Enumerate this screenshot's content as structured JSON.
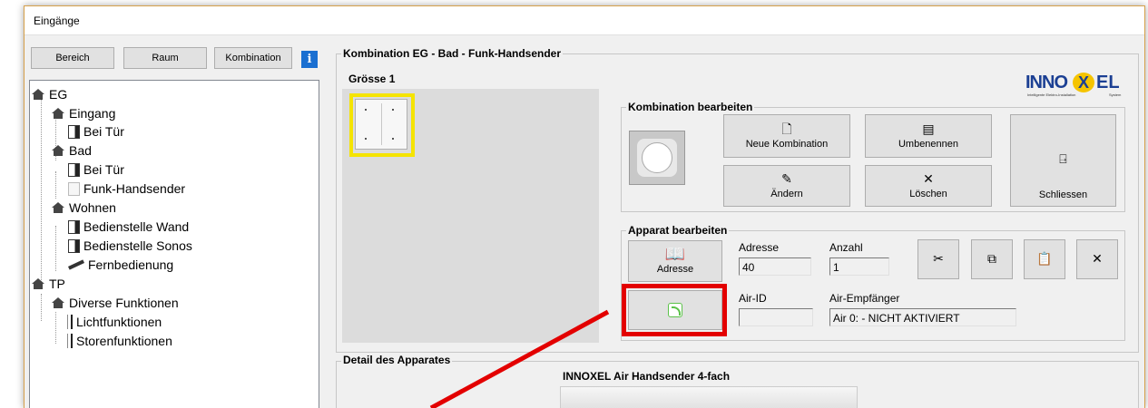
{
  "window": {
    "title": "Eingänge"
  },
  "toolbar": {
    "bereich": "Bereich",
    "raum": "Raum",
    "kombination": "Kombination",
    "info": "i"
  },
  "tree": [
    {
      "label": "EG",
      "kind": "house"
    },
    {
      "label": "Eingang",
      "kind": "house"
    },
    {
      "label": "Bei Tür",
      "kind": "switch"
    },
    {
      "label": "Bad",
      "kind": "house"
    },
    {
      "label": "Bei Tür",
      "kind": "switch"
    },
    {
      "label": "Funk-Handsender",
      "kind": "blank",
      "selected": true
    },
    {
      "label": "Wohnen",
      "kind": "house"
    },
    {
      "label": "Bedienstelle Wand",
      "kind": "switch"
    },
    {
      "label": "Bedienstelle Sonos",
      "kind": "switch"
    },
    {
      "label": "Fernbedienung",
      "kind": "remote"
    },
    {
      "label": "TP",
      "kind": "house"
    },
    {
      "label": "Diverse Funktionen",
      "kind": "house"
    },
    {
      "label": "Lichtfunktionen",
      "kind": "bar"
    },
    {
      "label": "Storenfunktionen",
      "kind": "bar"
    }
  ],
  "kombination": {
    "title": "Kombination EG - Bad - Funk-Handsender",
    "groesse": "Grösse 1",
    "logo": "INNOXEL",
    "logo_sub": "Intelligente Elektro-Installation",
    "logo_sys": "System",
    "bearbeiten_title": "Kombination bearbeiten",
    "neue": "Neue Kombination",
    "umbenennen": "Umbenennen",
    "aendern": "Ändern",
    "loeschen": "Löschen",
    "schliessen": "Schliessen"
  },
  "apparat": {
    "title": "Apparat bearbeiten",
    "adresse_btn": "Adresse",
    "adresse_label": "Adresse",
    "adresse_value": "40",
    "anzahl_label": "Anzahl",
    "anzahl_value": "1",
    "airid_label": "Air-ID",
    "airid_value": "",
    "empf_label": "Air-Empfänger",
    "empf_value": "Air 0:  - NICHT AKTIVIERT"
  },
  "detail": {
    "title": "Detail des Apparates",
    "device_name": "INNOXEL Air Handsender 4-fach"
  },
  "colors": {
    "highlight_yellow": "#f5e400",
    "annotation_red": "#e30000",
    "air_green": "#5cc24a"
  }
}
